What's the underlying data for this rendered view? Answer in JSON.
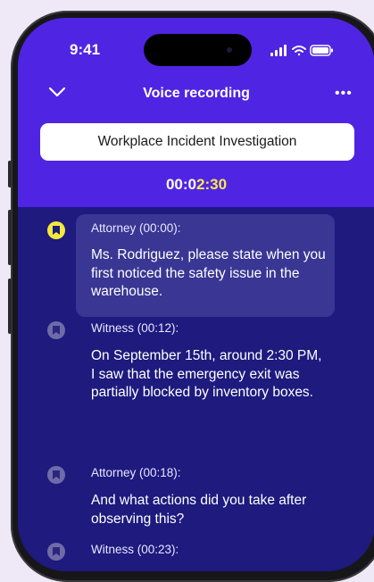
{
  "status_bar": {
    "time": "9:41"
  },
  "nav": {
    "title": "Voice recording"
  },
  "recording": {
    "title": "Workplace Incident Investigation",
    "timer_prefix": "00:0",
    "timer_highlight": "2:30"
  },
  "colors": {
    "header": "#4f25e3",
    "body": "#1e1a7e",
    "highlight": "#f3e93b",
    "active_bubble": "#3a3694"
  },
  "transcript": [
    {
      "speaker": "Attorney (00:00):",
      "text": "Ms. Rodriguez, please state when you first noticed the safety issue in the warehouse.",
      "active": true
    },
    {
      "speaker": "Witness (00:12):",
      "text": "On September 15th, around 2:30 PM, I saw that the emergency exit was partially blocked by inventory boxes.",
      "active": false
    },
    {
      "speaker": "Attorney (00:18):",
      "text": "And what actions did you take after observing this?",
      "active": false
    },
    {
      "speaker": "Witness (00:23):",
      "text": "",
      "active": false
    }
  ]
}
